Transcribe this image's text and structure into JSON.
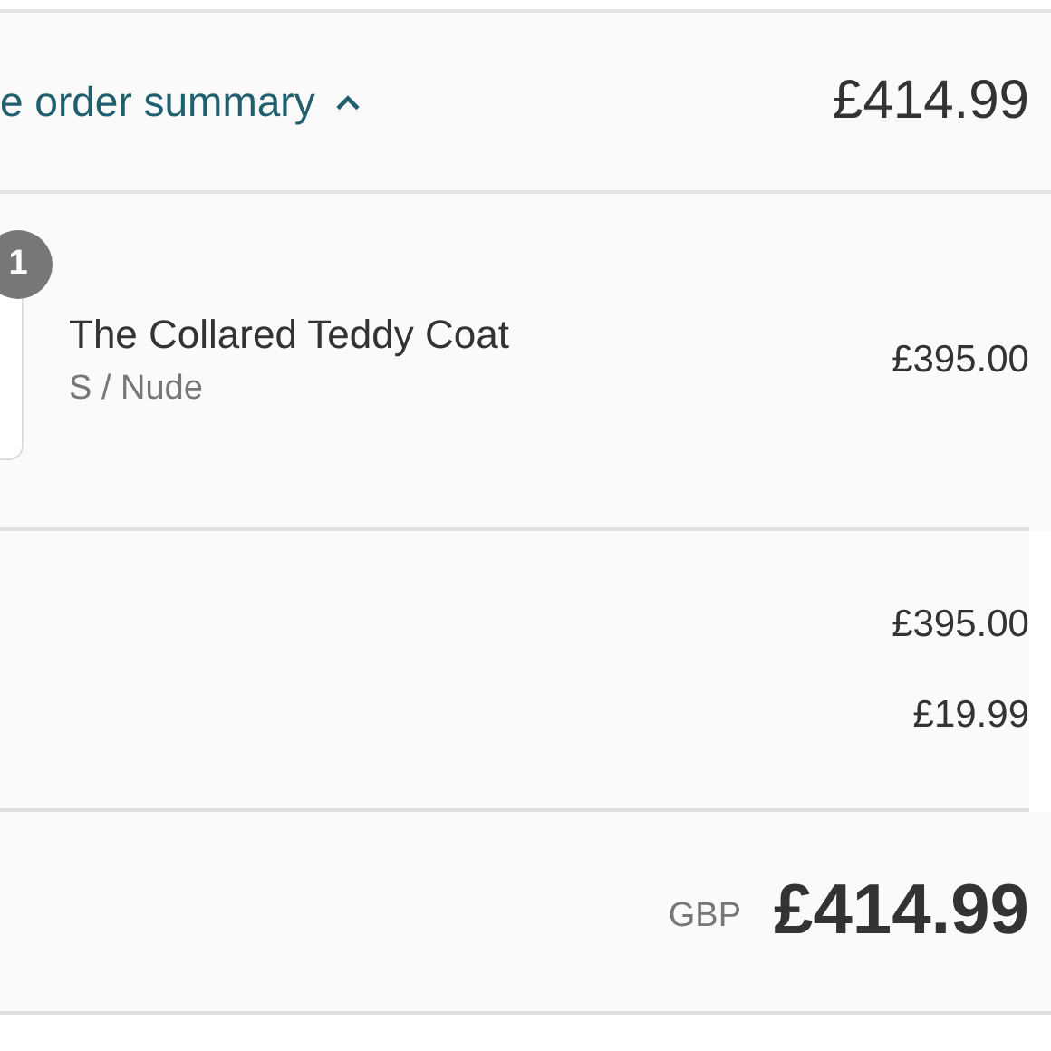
{
  "summary_bar": {
    "toggle_label": "e order summary",
    "expanded": true,
    "total": "£414.99"
  },
  "items": [
    {
      "quantity": "1",
      "name": "The Collared Teddy Coat",
      "variant": "S / Nude",
      "price": "£395.00"
    }
  ],
  "costs": [
    {
      "value": "£395.00"
    },
    {
      "value": "£19.99"
    }
  ],
  "total": {
    "currency": "GBP",
    "amount": "£414.99"
  }
}
